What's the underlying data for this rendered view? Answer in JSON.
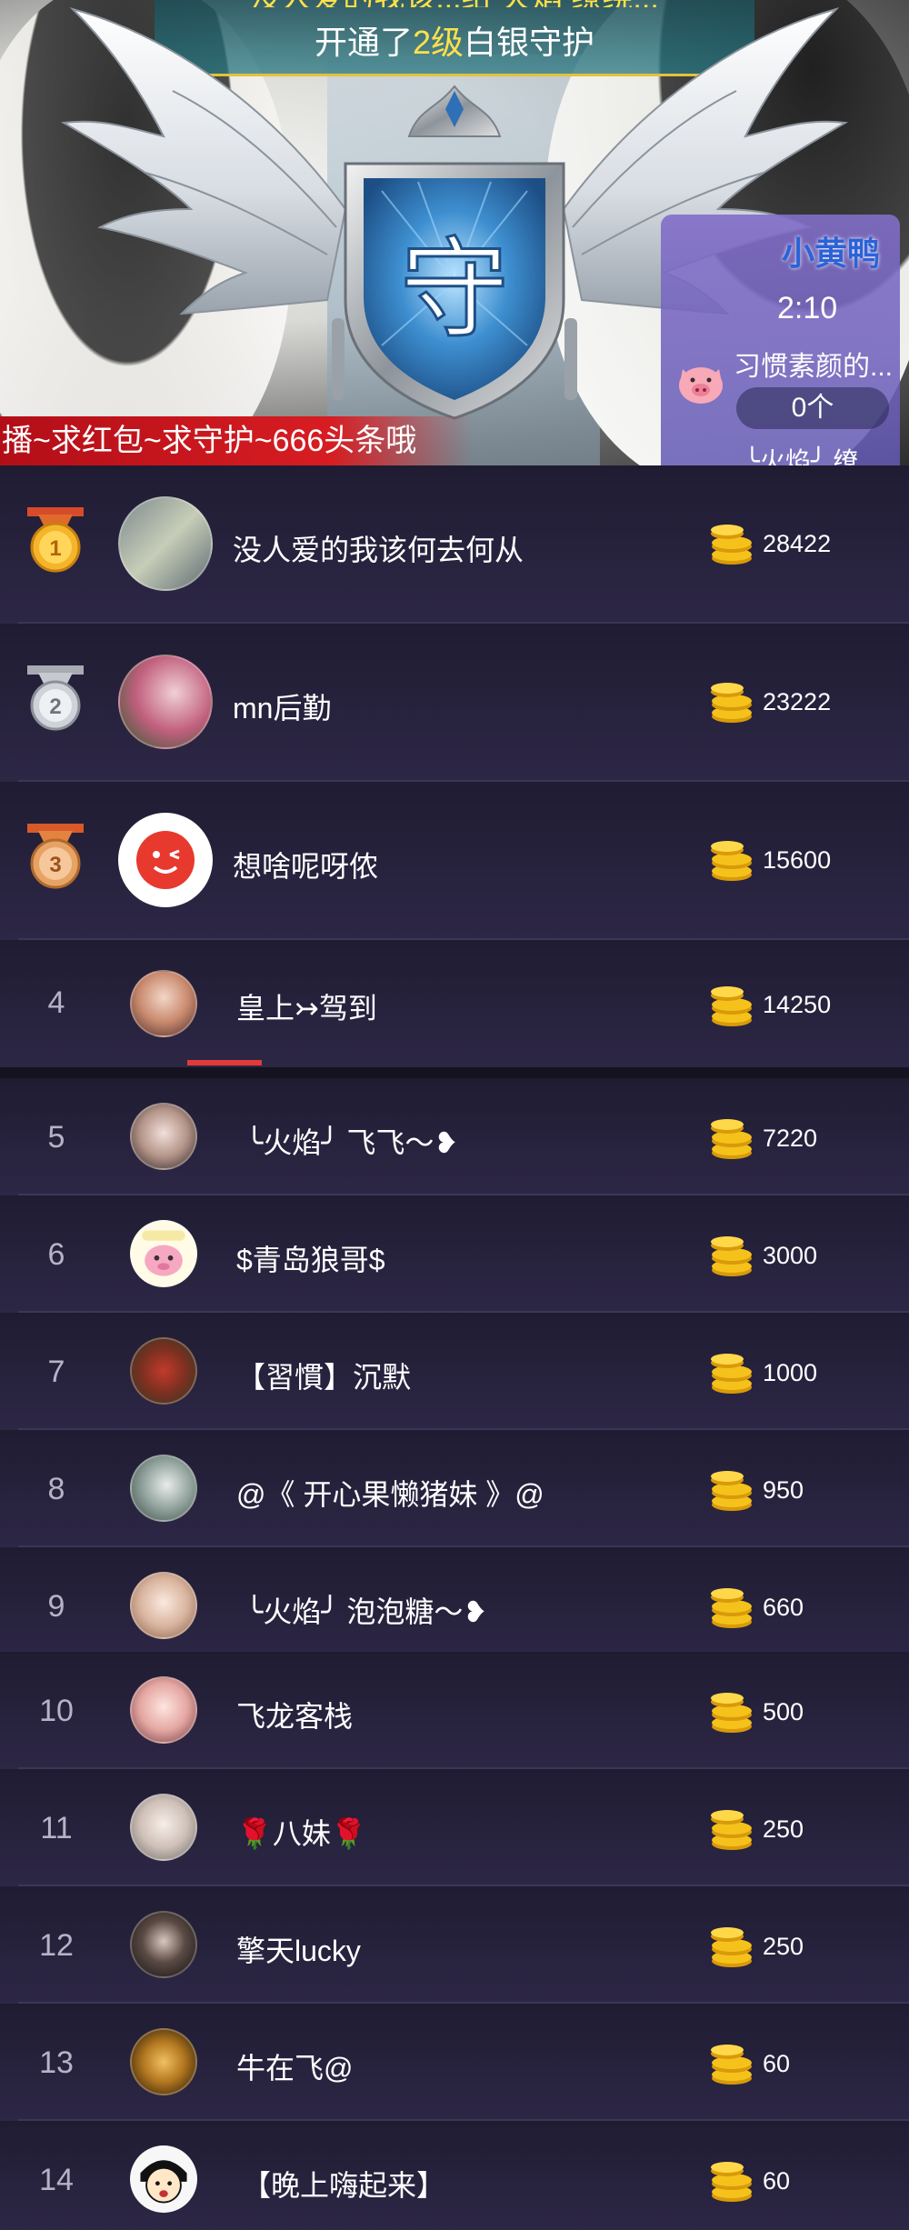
{
  "banner": {
    "message_line1": "没人爱的我该...给 火焰 缭绕...",
    "message_line2_prefix": "开通了",
    "message_line2_level": "2级",
    "message_line2_suffix": "白银守护",
    "emblem_char": "守",
    "side_panel": {
      "name": "小黄鸭",
      "time": "2:10",
      "desc": "习惯素颜的...",
      "count": "0个",
      "fire_text": "╰火焰╯ 缭"
    },
    "ticker_text": "播~求红包~求守护~666头条哦"
  },
  "colors": {
    "accent_gold": "#ffe04a",
    "ticker_red": "#d71d22",
    "tab_indicator": "#e03a3a"
  },
  "leaderboard": {
    "rows": [
      {
        "rank": "1",
        "medal": "gold-medal-icon",
        "name": "没人爱的我该何去何从",
        "amount": "28422"
      },
      {
        "rank": "2",
        "medal": "silver-medal-icon",
        "name": "mn后勤",
        "amount": "23222"
      },
      {
        "rank": "3",
        "medal": "bronze-medal-icon",
        "name": "想啥呢呀侬",
        "amount": "15600"
      },
      {
        "rank": "4",
        "name": "皇上↣驾到",
        "amount": "14250"
      },
      {
        "rank": "5",
        "name": "╰火焰╯ 飞飞～❥",
        "amount": "7220"
      },
      {
        "rank": "6",
        "name": "$青岛狼哥$",
        "amount": "3000"
      },
      {
        "rank": "7",
        "name": "【習慣】沉默",
        "amount": "1000"
      },
      {
        "rank": "8",
        "name": "@《 开心果懒猪妹 》@",
        "amount": "950"
      },
      {
        "rank": "9",
        "name": "╰火焰╯ 泡泡糖～❥",
        "amount": "660"
      },
      {
        "rank": "10",
        "name": "飞龙客栈",
        "amount": "500"
      },
      {
        "rank": "11",
        "name": "🌹八妹🌹",
        "amount": "250"
      },
      {
        "rank": "12",
        "name": "擎天lucky",
        "amount": "250"
      },
      {
        "rank": "13",
        "name": "牛在飞@",
        "amount": "60"
      },
      {
        "rank": "14",
        "name": "【晚上嗨起来】",
        "amount": "60"
      }
    ]
  }
}
